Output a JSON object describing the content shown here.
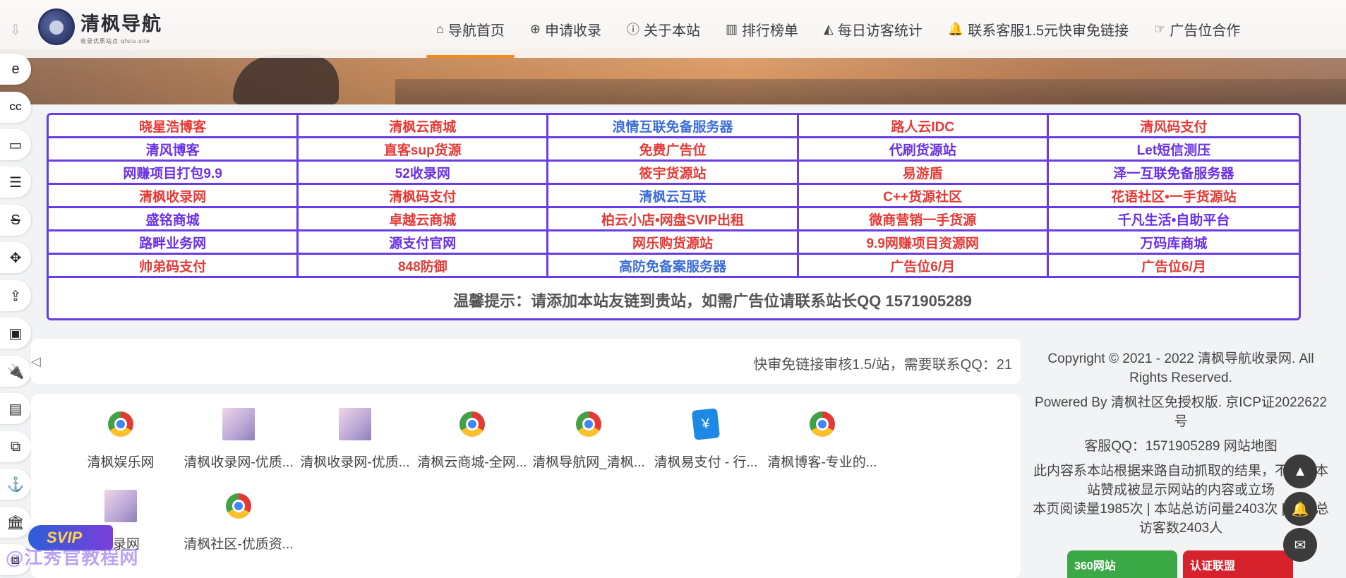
{
  "logo": {
    "title": "清枫导航",
    "subtitle": "收录优质站点 qfslu.site"
  },
  "nav": [
    {
      "icon": "⌂",
      "label": "导航首页",
      "active": true
    },
    {
      "icon": "⊕",
      "label": "申请收录",
      "active": false
    },
    {
      "icon": "ⓘ",
      "label": "关于本站",
      "active": false
    },
    {
      "icon": "▥",
      "label": "排行榜单",
      "active": false
    },
    {
      "icon": "◭",
      "label": "每日访客统计",
      "active": false
    },
    {
      "icon": "🔔",
      "label": "联系客服1.5元快审免链接",
      "active": false
    },
    {
      "icon": "☞",
      "label": "广告位合作",
      "active": false
    }
  ],
  "rail": [
    "⇩",
    "e",
    "CC",
    "▭",
    "☰",
    "S",
    "✥",
    "⇪",
    "▣",
    "🔌",
    "▤",
    "⧉",
    "⚓",
    "🏛",
    "⧈"
  ],
  "link_table": {
    "rows": [
      [
        {
          "t": "晓星浩博客",
          "c": "red"
        },
        {
          "t": "清枫云商城",
          "c": "red"
        },
        {
          "t": "浪情互联免备服务器",
          "c": "blue"
        },
        {
          "t": "路人云IDC",
          "c": "red"
        },
        {
          "t": "清风码支付",
          "c": "red"
        }
      ],
      [
        {
          "t": "清风博客",
          "c": "purple"
        },
        {
          "t": "直客sup货源",
          "c": "red"
        },
        {
          "t": "免费广告位",
          "c": "red"
        },
        {
          "t": "代刷货源站",
          "c": "purple"
        },
        {
          "t": "Let短信测压",
          "c": "purple"
        }
      ],
      [
        {
          "t": "网赚项目打包9.9",
          "c": "purple"
        },
        {
          "t": "52收录网",
          "c": "purple"
        },
        {
          "t": "筱宇货源站",
          "c": "red"
        },
        {
          "t": "易游盾",
          "c": "red"
        },
        {
          "t": "泽一互联免备服务器",
          "c": "purple"
        }
      ],
      [
        {
          "t": "清枫收录网",
          "c": "red"
        },
        {
          "t": "清枫码支付",
          "c": "red"
        },
        {
          "t": "清枫云互联",
          "c": "blue"
        },
        {
          "t": "C++货源社区",
          "c": "red"
        },
        {
          "t": "花语社区•一手货源站",
          "c": "red"
        }
      ],
      [
        {
          "t": "盛铭商城",
          "c": "purple"
        },
        {
          "t": "卓越云商城",
          "c": "red"
        },
        {
          "t": "柏云小店•网盘SVIP出租",
          "c": "red"
        },
        {
          "t": "微商营销一手货源",
          "c": "red"
        },
        {
          "t": "千凡生活•自助平台",
          "c": "purple"
        }
      ],
      [
        {
          "t": "路畔业务网",
          "c": "purple"
        },
        {
          "t": "源支付官网",
          "c": "purple"
        },
        {
          "t": "网乐购货源站",
          "c": "red"
        },
        {
          "t": "9.9网赚项目资源网",
          "c": "red"
        },
        {
          "t": "万码库商城",
          "c": "purple"
        }
      ],
      [
        {
          "t": "帅弟码支付",
          "c": "red"
        },
        {
          "t": "848防御",
          "c": "red"
        },
        {
          "t": "高防免备案服务器",
          "c": "blue"
        },
        {
          "t": "广告位6/月",
          "c": "red"
        },
        {
          "t": "广告位6/月",
          "c": "red"
        }
      ]
    ],
    "tip": "温馨提示：请添加本站友链到贵站，如需广告位请联系站长QQ 1571905289"
  },
  "notice": {
    "text": "快审免链接审核1.5/站，需要联系QQ：21"
  },
  "sites": [
    {
      "logo": "chrome",
      "name": "清枫娱乐网"
    },
    {
      "logo": "thumb",
      "name": "清枫收录网-优质..."
    },
    {
      "logo": "thumb",
      "name": "清枫收录网-优质..."
    },
    {
      "logo": "chrome",
      "name": "清枫云商城-全网..."
    },
    {
      "logo": "chrome",
      "name": "清枫导航网_清枫..."
    },
    {
      "logo": "pay",
      "name": "清枫易支付 - 行..."
    },
    {
      "logo": "chrome",
      "name": "清枫博客-专业的..."
    },
    {
      "logo": "thumb",
      "name": "...录网"
    },
    {
      "logo": "chrome",
      "name": "清枫社区-优质资..."
    }
  ],
  "footer": {
    "copyright": "Copyright © 2021 - 2022 清枫导航收录网. All Rights Reserved.",
    "powered": "Powered By 清枫社区免授权版. 京ICP证2022622号",
    "contact": "客服QQ：1571905289 网站地图",
    "disclaimer": "此内容系本站根据来路自动抓取的结果，不代表本站赞成被显示网站的内容或立场",
    "stats": "本页阅读量1985次 | 本站总访问量2403次 | 本站总访客数2403人",
    "badges": [
      "360网站",
      "认证联盟"
    ]
  },
  "fabs": [
    "▲",
    "🔔",
    "✉"
  ],
  "watermark": {
    "svip": "SVIP",
    "text": "@江秀官教程网"
  }
}
